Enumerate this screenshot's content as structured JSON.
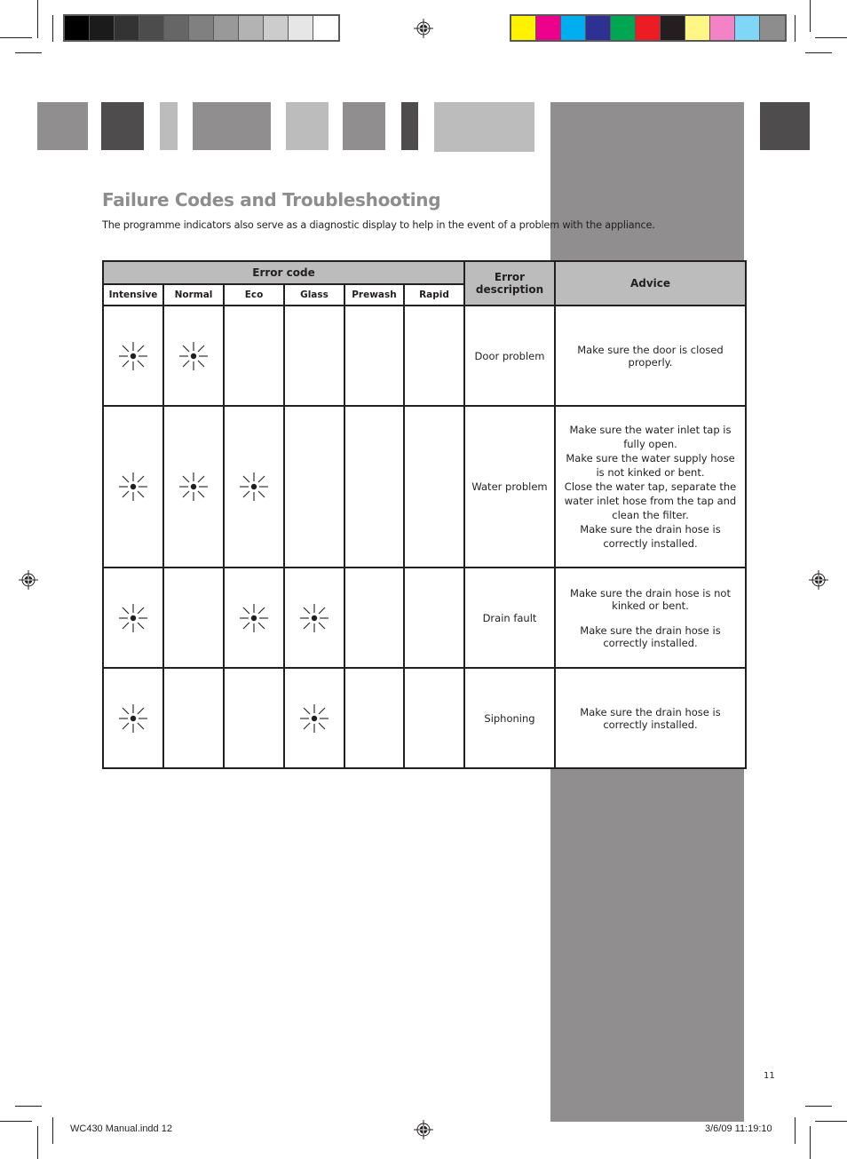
{
  "colors": {
    "grayscale_bar": [
      "#000000",
      "#1b1b1b",
      "#333333",
      "#4c4c4c",
      "#666666",
      "#808080",
      "#999999",
      "#b3b3b3",
      "#cccccc",
      "#e6e6e6",
      "#ffffff"
    ],
    "color_bar": [
      "#fff200",
      "#ec008c",
      "#00aeef",
      "#2e3192",
      "#00a651",
      "#ed1c24",
      "#231f20",
      "#fff685",
      "#f482c6",
      "#7fd6f7",
      "#8e8d8e"
    ],
    "tabs": [
      "#908e8f",
      "#4e4c4d",
      "#bcbcbc",
      "#908e8f",
      "#bcbcbc",
      "#908e8f",
      "#4e4c4d",
      "#bcbcbc",
      "#4e4c4d"
    ],
    "side_band": "#908e8f",
    "title": "#8e8c8d"
  },
  "page": {
    "title": "Failure Codes and Troubleshooting",
    "intro": "The programme indicators also serve as a diagnostic display to help in the event of a problem with the appliance.",
    "page_number": "11"
  },
  "table": {
    "header": {
      "error_code": "Error code",
      "error_description": "Error description",
      "advice": "Advice"
    },
    "programmes": [
      "Intensive",
      "Normal",
      "Eco",
      "Glass",
      "Prewash",
      "Rapid"
    ],
    "indicator_icon": "flashing-light-icon",
    "rows": [
      {
        "flashing": [
          true,
          true,
          false,
          false,
          false,
          false
        ],
        "description": "Door problem",
        "advice": [
          "Make sure the door is closed properly."
        ]
      },
      {
        "flashing": [
          true,
          true,
          true,
          false,
          false,
          false
        ],
        "description": "Water problem",
        "advice": [
          "Make sure the water inlet tap is fully open.",
          "Make sure the water supply hose is not kinked or bent.",
          "Close the water tap, separate the water inlet hose from the tap and clean the filter.",
          "Make sure the drain hose is correctly installed."
        ]
      },
      {
        "flashing": [
          true,
          false,
          true,
          true,
          false,
          false
        ],
        "description": "Drain fault",
        "advice": [
          "Make sure the drain hose is not kinked or bent.",
          "Make sure the drain hose is correctly installed."
        ]
      },
      {
        "flashing": [
          true,
          false,
          false,
          true,
          false,
          false
        ],
        "description": "Siphoning",
        "advice": [
          "Make sure the drain hose is correctly installed."
        ]
      }
    ]
  },
  "footer": {
    "file": "WC430 Manual.indd   12",
    "timestamp": "3/6/09   11:19:10"
  }
}
